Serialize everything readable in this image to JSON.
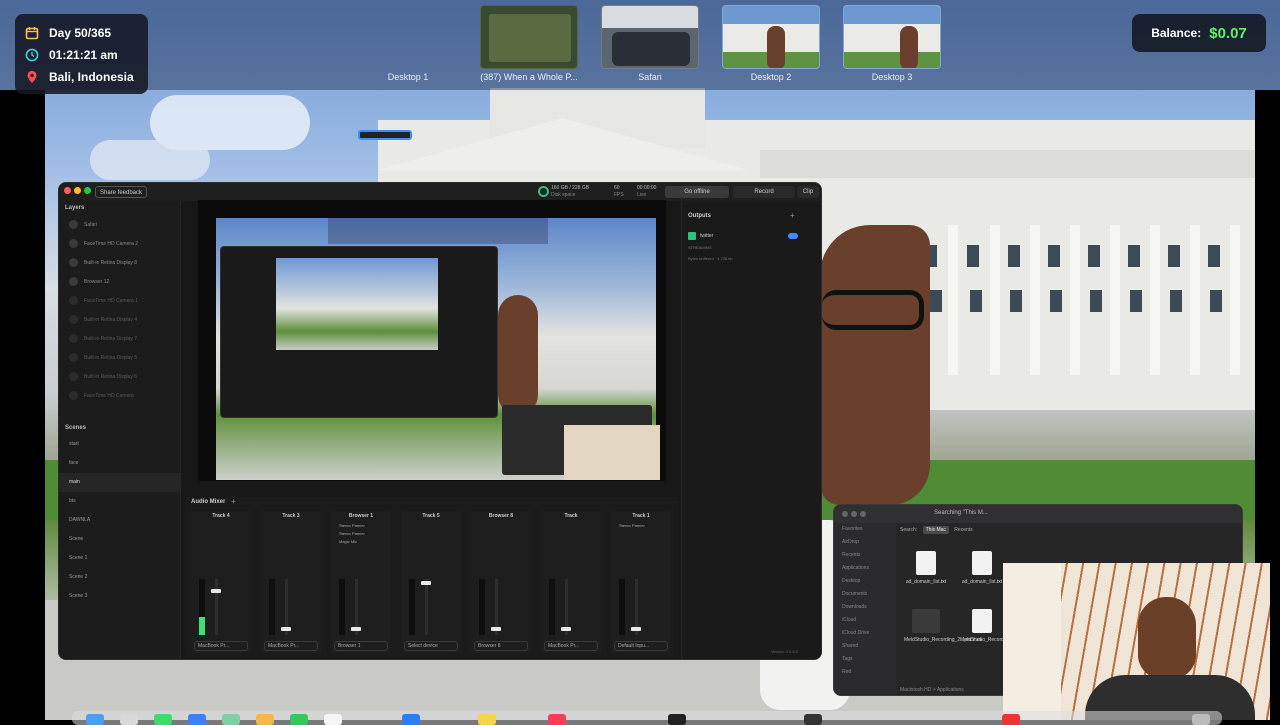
{
  "status": {
    "day": "Day 50/365",
    "time": "01:21:21 am",
    "location": "Bali, Indonesia",
    "balance_label": "Balance:",
    "balance_value": "$0.07"
  },
  "spaces": [
    {
      "label": "Desktop 1",
      "selected": true
    },
    {
      "label": "(387) When a Whole P...",
      "selected": false
    },
    {
      "label": "Safari",
      "selected": false
    },
    {
      "label": "Desktop 2",
      "selected": false
    },
    {
      "label": "Desktop 3",
      "selected": false
    }
  ],
  "app": {
    "share_feedback": "Share feedback",
    "disk": "160 GB / 228 GB",
    "disk_label": "Disk space",
    "fps": "60",
    "fps_label": "FPS",
    "live_time": "00:00:00",
    "live_label": "Live",
    "go_offline": "Go offline",
    "record": "Record",
    "clip": "Clip",
    "layers_title": "Layers",
    "layers": [
      "Safari",
      "FaceTime HD Camera 2",
      "Built-in Retina Display 8",
      "Browser 12",
      "FaceTime HD Camera 1",
      "Built-in Retina Display 4",
      "Built-in Retina Display 7",
      "Built-in Retina Display 5",
      "Built-in Retina Display 6",
      "FaceTime HD Camera"
    ],
    "scenes_title": "Scenes",
    "scenes": [
      "start",
      "face",
      "main",
      "bts",
      "DAWNLA",
      "Scene",
      "Scene 1",
      "Scene 2",
      "Scene 3"
    ],
    "active_scene": "main",
    "outputs_title": "Outputs",
    "output_name": "twitter",
    "output_status": "STREAMING",
    "output_detail": "Bytes buffered · 4.726 kb",
    "mixer_title": "Audio Mixer",
    "tracks": [
      {
        "name": "Track 4",
        "device": "MacBook Pr..."
      },
      {
        "name": "Track 3",
        "device": "MacBook Pr..."
      },
      {
        "name": "Browser 1",
        "device": "Browser 1",
        "effects": [
          "Stereo Panner",
          "Stereo Panner",
          "Magic Mic"
        ]
      },
      {
        "name": "Track 5",
        "device": "Select device"
      },
      {
        "name": "Browser 8",
        "device": "Browser 8"
      },
      {
        "name": "Track",
        "device": "MacBook Pr..."
      },
      {
        "name": "Track 1",
        "device": "Default Inpu...",
        "effects": [
          "Stereo Panner"
        ]
      }
    ],
    "version": "Version 0.9.4.3"
  },
  "finder": {
    "search_title": "Searching \"This M...",
    "scope": [
      "Search:",
      "This Mac",
      "Recents"
    ],
    "sidebar": [
      "Favorites",
      "AirDrop",
      "Recents",
      "Applications",
      "Desktop",
      "Documents",
      "Downloads",
      "iCloud",
      "iCloud Drive",
      "Shared",
      "Tags",
      "Red",
      "Gold",
      "Purple"
    ],
    "files": [
      "ad_domain_list.txt",
      "ad_domain_list.txt",
      "MeldStudio_Recording_2...pm.mov",
      "MeldStudio_Recording_2...7am.mov"
    ],
    "path": "Macintosh HD > Applications"
  },
  "colors": {
    "accent": "#3c8cff",
    "balance": "#5cf56a",
    "calendar": "#f5c542",
    "clock": "#3fd0e0",
    "pin": "#ff4d4d"
  }
}
